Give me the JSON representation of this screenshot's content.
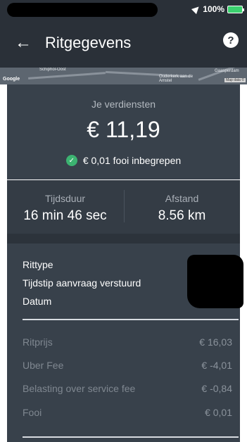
{
  "status_bar": {
    "battery": "100%"
  },
  "header": {
    "title": "Ritgegevens",
    "back_icon": "arrow-left-icon",
    "help_label": "?"
  },
  "map": {
    "attribution": "Google",
    "labels": [
      "Schiphol-Oost",
      "Ouderkerk aan de Amstel",
      "Gaasperdam"
    ],
    "map_data": "Map data ©"
  },
  "earnings": {
    "label": "Je verdiensten",
    "amount": "€ 11,19",
    "tip_text": "€ 0,01 fooi inbegrepen"
  },
  "stats": {
    "duration_label": "Tijdsduur",
    "duration_value": "16 min 46 sec",
    "distance_label": "Afstand",
    "distance_value": "8.56 km"
  },
  "trip_info": {
    "labels": [
      "Rittype",
      "Tijdstip aanvraag verstuurd",
      "Datum"
    ]
  },
  "fees": [
    {
      "label": "Ritprijs",
      "amount": "€ 16,03"
    },
    {
      "label": "Uber Fee",
      "amount": "€ -4,01"
    },
    {
      "label": "Belasting over service fee",
      "amount": "€ -0,84"
    },
    {
      "label": "Fooi",
      "amount": "€ 0,01"
    }
  ],
  "colors": {
    "header_bg": "#2a3038",
    "card_bg": "#38414b",
    "accent_green": "#3cb371"
  }
}
